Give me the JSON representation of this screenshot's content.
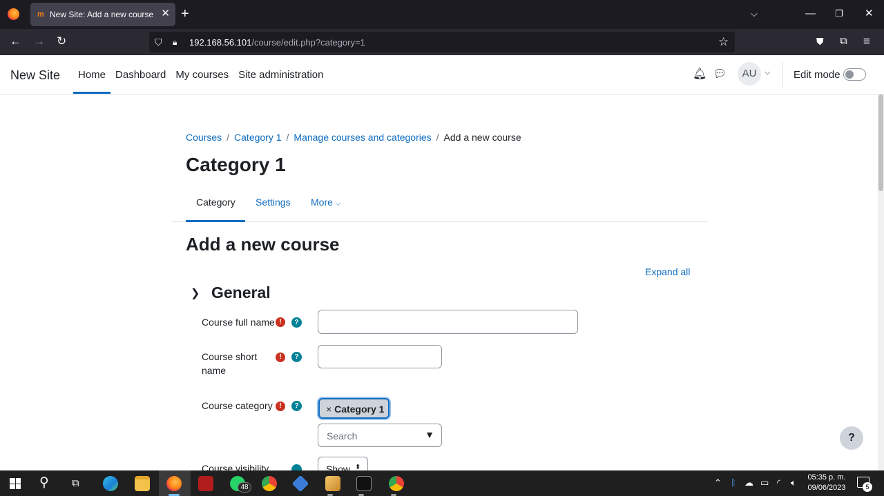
{
  "browser": {
    "tab_title": "New Site: Add a new course",
    "tab_favicon": "moodle-icon",
    "url_host": "192.168.56.101",
    "url_path": "/course/edit.php?category=1"
  },
  "header": {
    "site_name": "New Site",
    "nav": [
      "Home",
      "Dashboard",
      "My courses",
      "Site administration"
    ],
    "active_nav": "Home",
    "avatar_initials": "AU",
    "edit_mode_label": "Edit mode",
    "edit_mode_on": false
  },
  "breadcrumb": {
    "items": [
      "Courses",
      "Category 1",
      "Manage courses and categories"
    ],
    "current": "Add a new course"
  },
  "page": {
    "title": "Category 1",
    "tabs": [
      "Category",
      "Settings",
      "More"
    ],
    "active_tab": "Category",
    "form_title": "Add a new course",
    "expand_all": "Expand all",
    "section_title": "General"
  },
  "form": {
    "full_name_label": "Course full name",
    "full_name_value": "",
    "short_name_label": "Course short name",
    "short_name_value": "",
    "category_label": "Course category",
    "category_selected": "Category 1",
    "category_search_placeholder": "Search",
    "visibility_label": "Course visibility",
    "visibility_value": "Show"
  },
  "help_button": "?",
  "taskbar": {
    "whatsapp_badge": "48",
    "time": "05:35 p. m.",
    "date": "09/06/2023",
    "notification_count": "5"
  },
  "colors": {
    "accent": "#0f6cbf",
    "required": "#ca3120",
    "help": "#008196"
  }
}
